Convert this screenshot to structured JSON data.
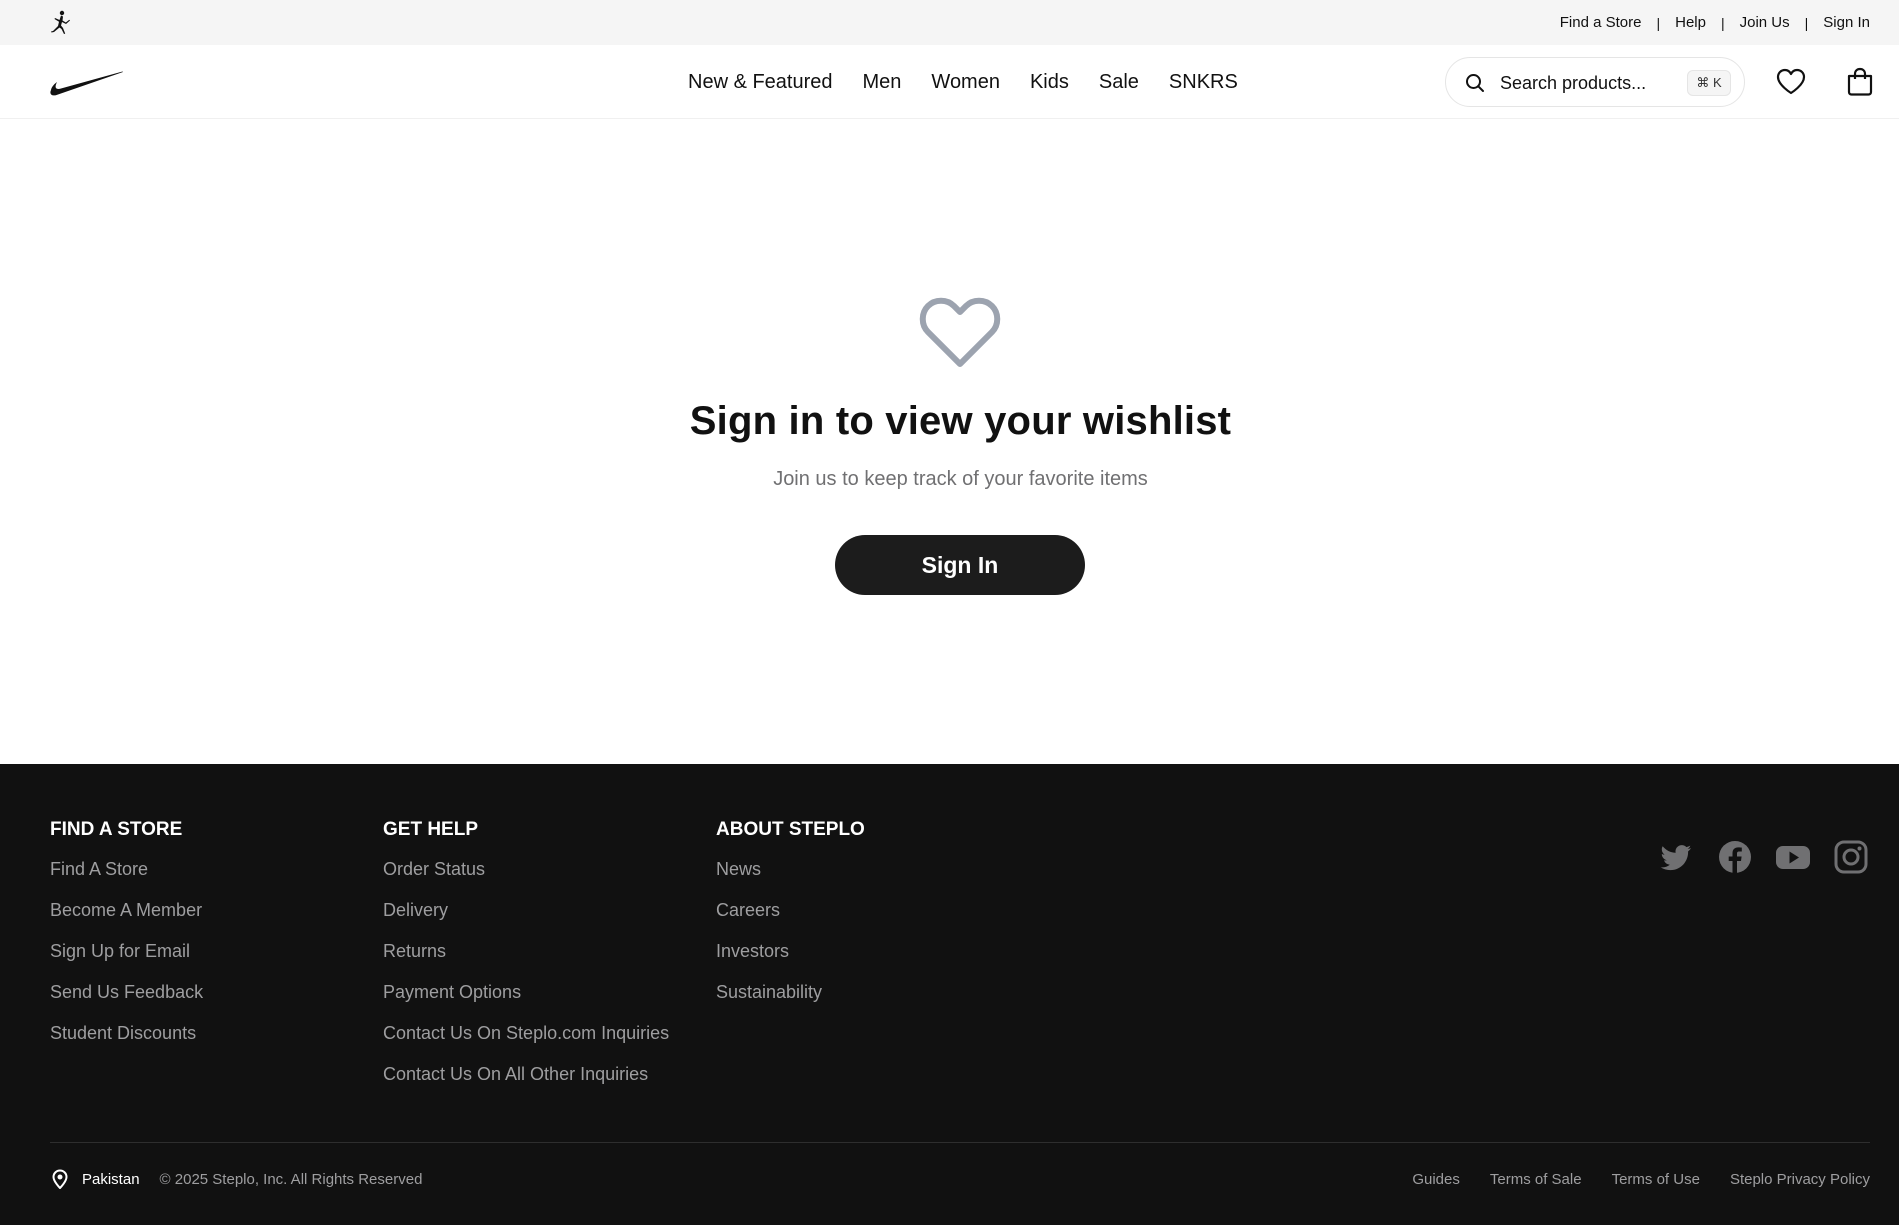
{
  "utility_bar": {
    "links": [
      "Find a Store",
      "Help",
      "Join Us",
      "Sign In"
    ],
    "separator": "|"
  },
  "header": {
    "nav": [
      "New & Featured",
      "Men",
      "Women",
      "Kids",
      "Sale",
      "SNKRS"
    ],
    "search": {
      "placeholder": "Search products...",
      "shortcut": "⌘ K"
    }
  },
  "empty_state": {
    "title": "Sign in to view your wishlist",
    "subtitle": "Join us to keep track of your favorite items",
    "button": "Sign In"
  },
  "footer": {
    "columns": [
      {
        "title": "FIND A STORE",
        "items": [
          "Find A Store",
          "Become A Member",
          "Sign Up for Email",
          "Send Us Feedback",
          "Student Discounts"
        ]
      },
      {
        "title": "GET HELP",
        "items": [
          "Order Status",
          "Delivery",
          "Returns",
          "Payment Options",
          "Contact Us On Steplo.com Inquiries",
          "Contact Us On All Other Inquiries"
        ]
      },
      {
        "title": "ABOUT STEPLO",
        "items": [
          "News",
          "Careers",
          "Investors",
          "Sustainability"
        ]
      }
    ],
    "social_icons": [
      "twitter-icon",
      "facebook-icon",
      "youtube-icon",
      "instagram-icon"
    ],
    "country": "Pakistan",
    "copyright": "© 2025 Steplo, Inc. All Rights Reserved",
    "legal": [
      "Guides",
      "Terms of Sale",
      "Terms of Use",
      "Steplo Privacy Policy"
    ]
  },
  "colors": {
    "utility_bg": "#f5f5f5",
    "footer_bg": "#111111",
    "button_bg": "#1c1c1c",
    "heart_icon": "#9ca3af",
    "muted_text": "#707072"
  }
}
